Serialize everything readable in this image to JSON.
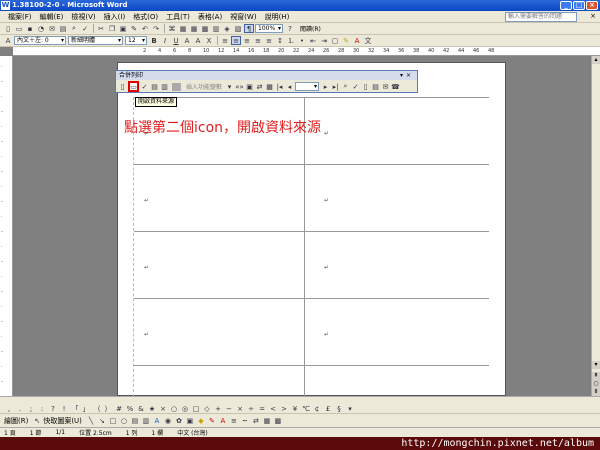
{
  "window": {
    "title": "1.38100-2-0 - Microsoft Word"
  },
  "menu": {
    "items": [
      "檔案(F)",
      "編輯(E)",
      "檢視(V)",
      "插入(I)",
      "格式(O)",
      "工具(T)",
      "表格(A)",
      "視窗(W)",
      "說明(H)"
    ],
    "help_placeholder": "輸入需要解答的問題"
  },
  "toolbar": {
    "zoom": "100%",
    "style": "內文＋左: 0",
    "font": "新細明體",
    "size": "12",
    "reading_label": "閱讀(R)"
  },
  "ruler": {
    "ticks": [
      "2",
      "4",
      "6",
      "8",
      "10",
      "12",
      "14",
      "16",
      "18",
      "20",
      "22",
      "24",
      "26",
      "28",
      "30",
      "32",
      "34",
      "36",
      "38",
      "40",
      "42",
      "44",
      "46",
      "48"
    ]
  },
  "mergebar": {
    "title": "合併列印",
    "insert_field_label": "插入功能變數",
    "tooltip": "開啟資料來源"
  },
  "annotation": {
    "text": "點選第二個icon，開啟資料來源",
    "color": "#e02020"
  },
  "drawbar": {
    "label": "繪圖(R)",
    "autoshapes": "快取圖案(U)"
  },
  "status": {
    "page": "1 頁",
    "section": "1 節",
    "pos": "1/1",
    "at": "位置 2.5cm",
    "line": "1 列",
    "col": "1 欄",
    "lang": "中文 (台灣)"
  },
  "watermark": "http://mongchin.pixnet.net/album",
  "colors": {
    "accent": "#0a46c4",
    "highlight": "#e00000"
  }
}
